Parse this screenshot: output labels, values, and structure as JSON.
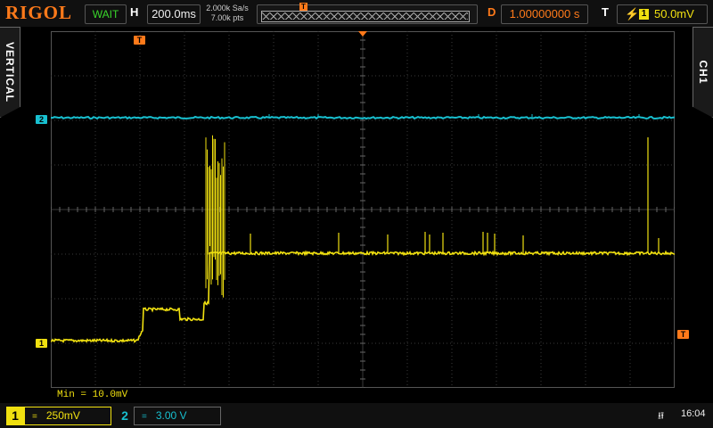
{
  "brand": "RIGOL",
  "topbar": {
    "status": "WAIT",
    "horizontal_label": "H",
    "timebase": "200.0ms",
    "sample_rate": "2.000k Sa/s",
    "memory_depth": "7.00k pts",
    "trigger_marker": "T",
    "delay_label": "D",
    "delay_value": "1.00000000 s",
    "trigger_label": "T",
    "trigger_edge": "⚡",
    "trigger_source": "1",
    "trigger_level": "50.0mV"
  },
  "side": {
    "left_tab": "VERTICAL",
    "right_tab": "CH1"
  },
  "measurement": "Min = 10.0mV",
  "channels": [
    {
      "num": "1",
      "coupling": "=",
      "scale": "250mV",
      "color": "#f0e010"
    },
    {
      "num": "2",
      "coupling": "=",
      "scale": "3.00 V",
      "color": "#18c0d0"
    }
  ],
  "markers": {
    "ch1": "1",
    "ch2": "2",
    "trigger_pos": "T",
    "trigger_level": "T"
  },
  "clock": "16:04",
  "icons": {
    "usb": "usb-icon",
    "trigger_edge": "rising-edge-icon"
  },
  "colors": {
    "ch1": "#f0e010",
    "ch2": "#18c0d0",
    "trigger": "#ff7a1a",
    "grid": "#3a3a3a"
  }
}
